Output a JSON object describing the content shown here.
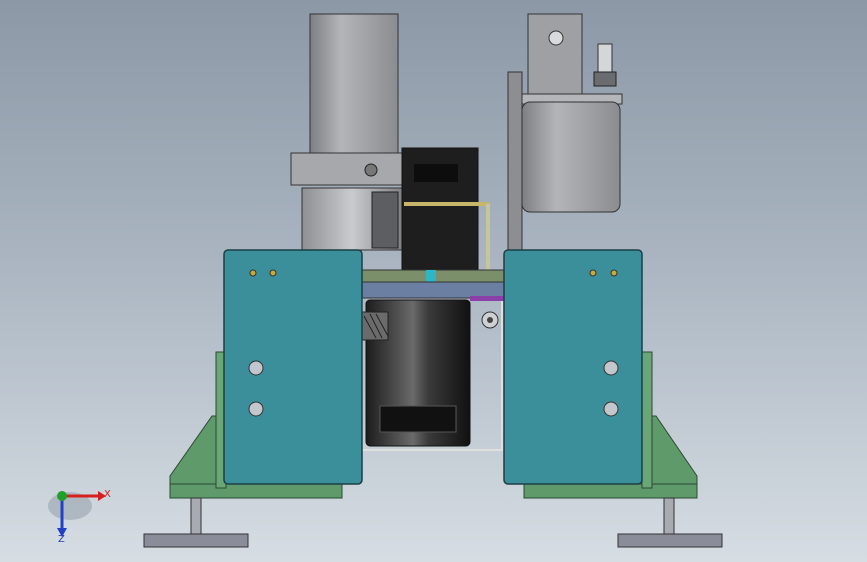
{
  "viewport": {
    "background_top": "#8c98a6",
    "background_bottom": "#d6dde3"
  },
  "colors": {
    "plate_teal": "#3a8f9b",
    "base_green": "#5e9a6a",
    "motor_gray": "#9a9c9f",
    "dark_body": "#2a2a2a",
    "foot_gray": "#8a8d99",
    "axis_x": "#d62020",
    "axis_y": "#1fa02a",
    "axis_z": "#2040c8"
  },
  "triad": {
    "x_label": "X",
    "z_label": "Z"
  }
}
